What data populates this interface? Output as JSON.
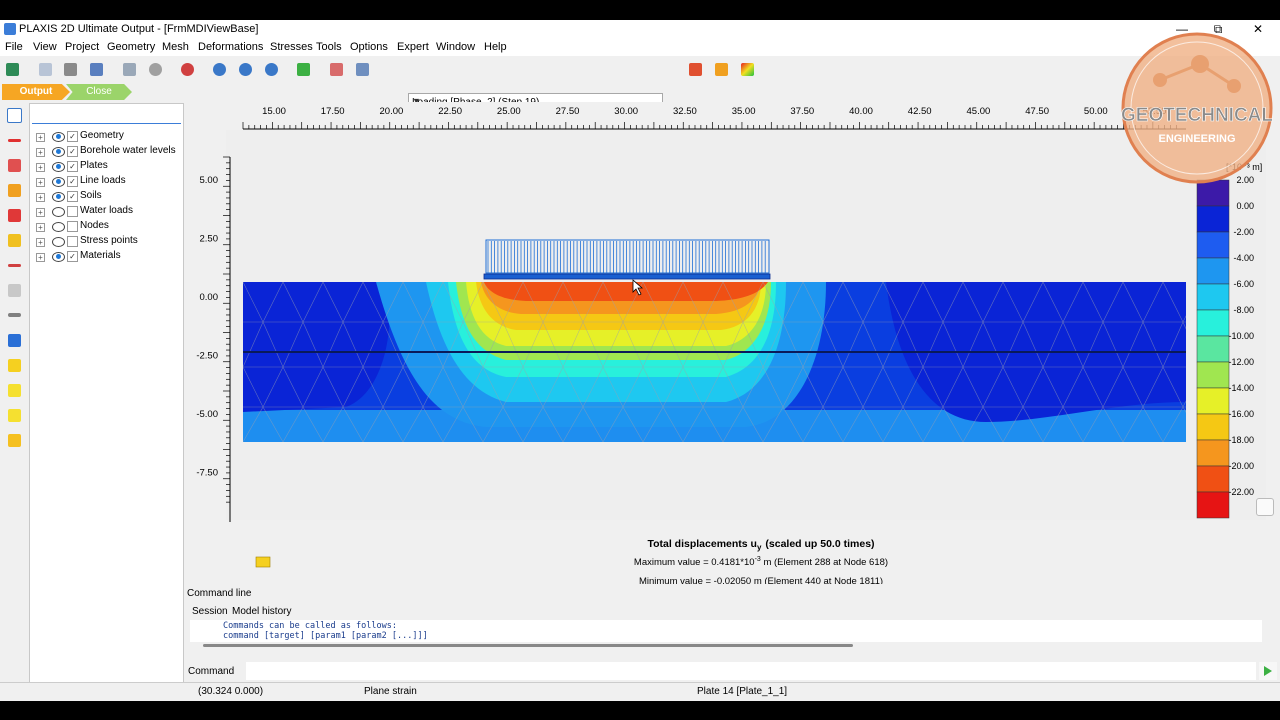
{
  "window": {
    "title": "PLAXIS 2D Ultimate Output - [FrmMDIViewBase]",
    "min_glyph": "—",
    "max_glyph": "⧉",
    "close_glyph": "✕"
  },
  "menu": [
    "File",
    "View",
    "Project",
    "Geometry",
    "Mesh",
    "Deformations",
    "Stresses",
    "Tools",
    "Options",
    "Expert",
    "Window",
    "Help"
  ],
  "phase_select": {
    "value": "Loading [Phase_2] (Step 19)"
  },
  "tabs": {
    "output": "Output",
    "close": "Close"
  },
  "tree": [
    {
      "label": "Geometry",
      "visible": true,
      "checked": true
    },
    {
      "label": "Borehole water levels",
      "visible": true,
      "checked": true
    },
    {
      "label": "Plates",
      "visible": true,
      "checked": true
    },
    {
      "label": "Line loads",
      "visible": true,
      "checked": true
    },
    {
      "label": "Soils",
      "visible": true,
      "checked": true
    },
    {
      "label": "Water loads",
      "visible": false,
      "checked": false
    },
    {
      "label": "Nodes",
      "visible": false,
      "checked": false
    },
    {
      "label": "Stress points",
      "visible": false,
      "checked": false
    },
    {
      "label": "Materials",
      "visible": true,
      "checked": true
    }
  ],
  "plot": {
    "x_ticks": [
      "15.00",
      "17.50",
      "20.00",
      "22.50",
      "25.00",
      "27.50",
      "30.00",
      "32.50",
      "35.00",
      "37.50",
      "40.00",
      "42.50",
      "45.00",
      "47.50",
      "50.00",
      "52.50"
    ],
    "y_ticks": [
      "5.00",
      "2.50",
      "0.00",
      "-2.50",
      "-5.00",
      "-7.50"
    ],
    "legend_unit": "[*10⁻³ m]",
    "legend_ticks": [
      "2.00",
      "0.00",
      "-2.00",
      "-4.00",
      "-6.00",
      "-8.00",
      "-10.00",
      "-12.00",
      "-14.00",
      "-16.00",
      "-18.00",
      "-20.00",
      "-22.00"
    ],
    "legend_colors": [
      "#3c1aa8",
      "#0a24d6",
      "#1e5cf0",
      "#1e96f0",
      "#1ec8f0",
      "#28f0dc",
      "#5ae6a0",
      "#a0e650",
      "#e6f028",
      "#f5c814",
      "#f5961e",
      "#f05014",
      "#e61414"
    ],
    "caption_title": "Total displacements u",
    "caption_sub": "y",
    "caption_scale": "(scaled up 50.0 times)",
    "max_prefix": "Maximum value = 0.4181*10",
    "max_exp": "-3",
    "max_suffix": " m (Element 288 at Node 618)",
    "min_text": "Minimum value = -0.02050 m (Element 440 at Node 1811)"
  },
  "overlay": {
    "logo_line1": "GEOTECHNICAL",
    "logo_line2": "ENGINEERING"
  },
  "command": {
    "title": "Command line",
    "tab_session": "Session",
    "tab_history": "Model history",
    "line1": "Commands can be called as follows:",
    "line2": "  command [target] [param1 [param2 [...]]]",
    "input_label": "Command"
  },
  "status": {
    "coords": "(30.324 0.000)",
    "mode": "Plane strain",
    "selection": "Plate 14 [Plate_1_1]"
  }
}
